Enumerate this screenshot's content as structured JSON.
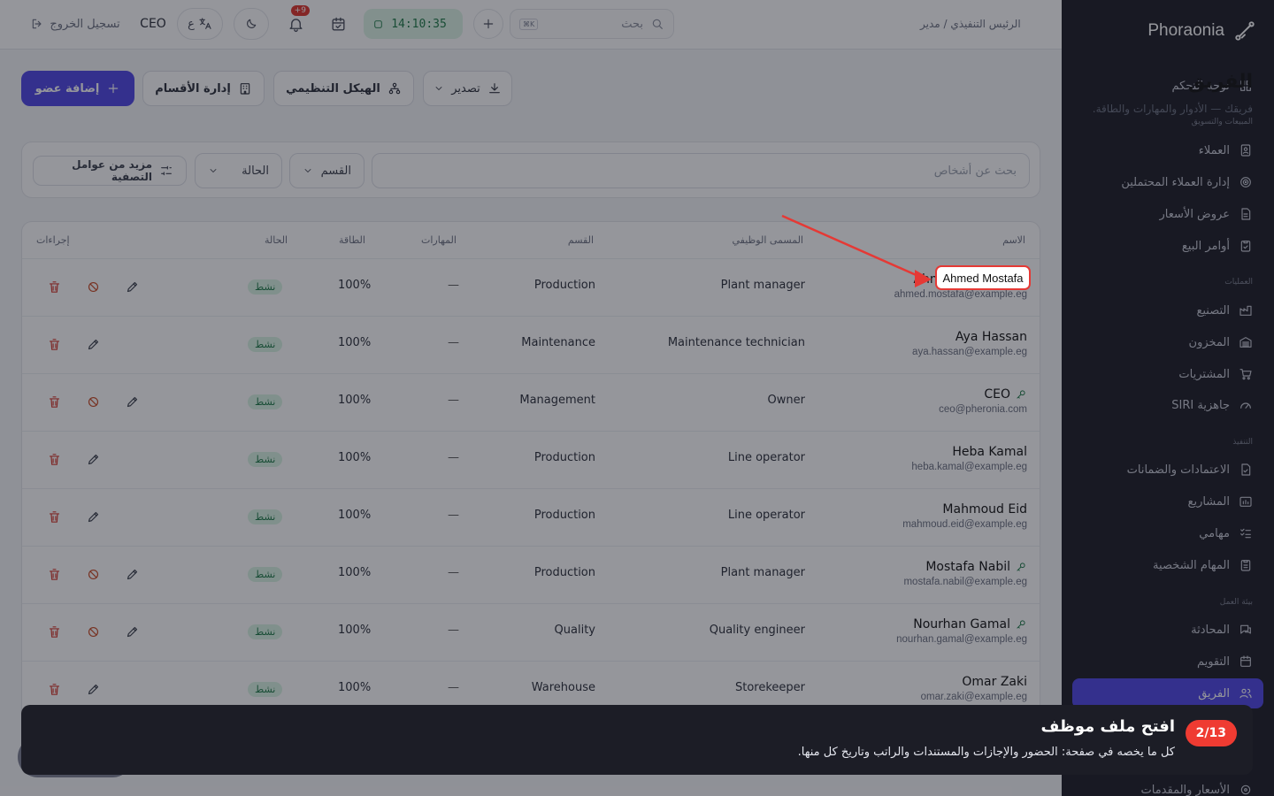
{
  "app": {
    "brand": "Phoraonia"
  },
  "topbar": {
    "breadcrumb": "الرئيس التنفيذي / مدير",
    "search_placeholder": "بحث",
    "search_kbd": "K⌘",
    "clock": "14:10:35",
    "notif_count": "+9",
    "user": "CEO",
    "lang_icon_text": "ع",
    "logout_label": "تسجيل الخروج"
  },
  "sidebar": {
    "dashboard": "لوحة التحكم",
    "section_sales": "المبيعات والتسويق",
    "clients": "العملاء",
    "leads": "إدارة العملاء المحتملين",
    "quotes": "عروض الأسعار",
    "sales_orders": "أوامر البيع",
    "section_ops": "العمليات",
    "manufacturing": "التصنيع",
    "inventory": "المخزون",
    "purchasing": "المشتريات",
    "siri": "جاهزية SIRI",
    "section_exec": "التنفيذ",
    "approvals": "الاعتمادات والضمانات",
    "projects": "المشاريع",
    "tasks": "مهامي",
    "personal_tasks": "المهام الشخصية",
    "section_work": "بيئة العمل",
    "chat": "المحادثة",
    "calendar": "التقويم",
    "team": "الفريق",
    "bottom": "الأسعار والمقدمات"
  },
  "header": {
    "title": "الفريق",
    "subtitle": "فريقك — الأدوار والمهارات والطاقة.",
    "add_member": "إضافة عضو",
    "departments": "إدارة الأقسام",
    "org_chart": "الهيكل التنظيمي",
    "export": "تصدير"
  },
  "filters": {
    "search_placeholder": "بحث عن أشخاص",
    "department": "القسم",
    "status": "الحالة",
    "more": "مزيد من عوامل التصفية"
  },
  "table": {
    "columns": {
      "name": "الاسم",
      "title": "المسمى الوظيفي",
      "department": "القسم",
      "skills": "المهارات",
      "energy": "الطاقة",
      "status": "الحالة",
      "actions": "إجراءات"
    },
    "rows": [
      {
        "name": "Ahmed Mostafa",
        "email": "ahmed.mostafa@example.eg",
        "title": "Plant manager",
        "department": "Production",
        "skills": "—",
        "energy": "100%",
        "status": "نشط"
      },
      {
        "name": "Aya Hassan",
        "email": "aya.hassan@example.eg",
        "title": "Maintenance technician",
        "department": "Maintenance",
        "skills": "—",
        "energy": "100%",
        "status": "نشط"
      },
      {
        "name": "CEO",
        "email": "ceo@pheronia.com",
        "title": "Owner",
        "department": "Management",
        "skills": "—",
        "energy": "100%",
        "status": "نشط"
      },
      {
        "name": "Heba Kamal",
        "email": "heba.kamal@example.eg",
        "title": "Line operator",
        "department": "Production",
        "skills": "—",
        "energy": "100%",
        "status": "نشط"
      },
      {
        "name": "Mahmoud Eid",
        "email": "mahmoud.eid@example.eg",
        "title": "Line operator",
        "department": "Production",
        "skills": "—",
        "energy": "100%",
        "status": "نشط"
      },
      {
        "name": "Mostafa Nabil",
        "email": "mostafa.nabil@example.eg",
        "title": "Plant manager",
        "department": "Production",
        "skills": "—",
        "energy": "100%",
        "status": "نشط"
      },
      {
        "name": "Nourhan Gamal",
        "email": "nourhan.gamal@example.eg",
        "title": "Quality engineer",
        "department": "Quality",
        "skills": "—",
        "energy": "100%",
        "status": "نشط"
      },
      {
        "name": "Omar Zaki",
        "email": "omar.zaki@example.eg",
        "title": "Storekeeper",
        "department": "Warehouse",
        "skills": "—",
        "energy": "100%",
        "status": "نشط"
      }
    ]
  },
  "tour": {
    "step": "2/13",
    "title": "افتح ملف موظف",
    "description": "كل ما يخصه في صفحة: الحضور والإجازات والمستندات والراتب وتاريخ كل منها."
  }
}
